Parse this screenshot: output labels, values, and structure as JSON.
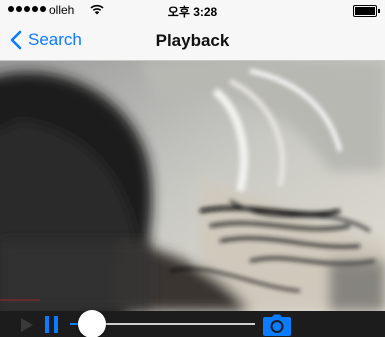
{
  "status_bar": {
    "carrier": "olleh",
    "time": "오후 3:28",
    "signal_bars": 5,
    "icons": [
      "wifi-icon",
      "battery-icon"
    ]
  },
  "nav": {
    "back_label": "Search",
    "back_icon": "chevron-left-icon",
    "title": "Playback"
  },
  "player": {
    "progress": 0.12,
    "icons": [
      "play-icon",
      "pause-icon",
      "camera-icon"
    ]
  },
  "colors": {
    "accent": "#0a7cff",
    "bar_background": "#f7f7f7",
    "control_background": "#1c1c1c"
  }
}
